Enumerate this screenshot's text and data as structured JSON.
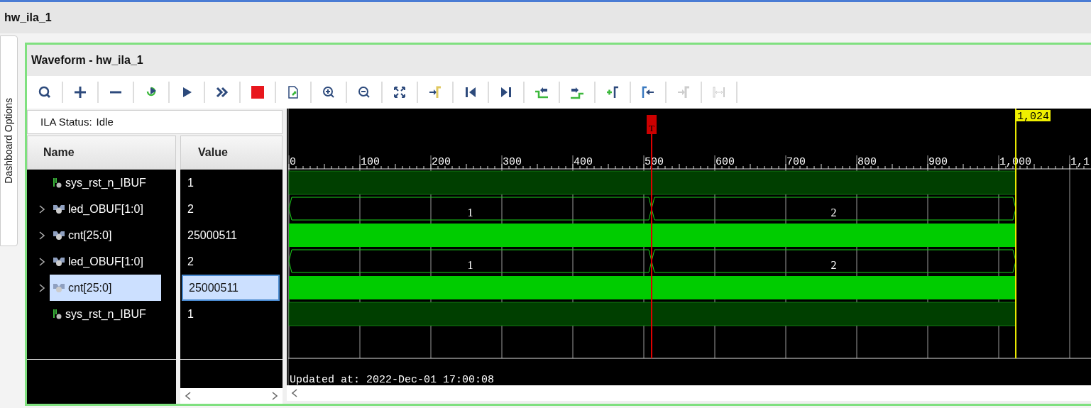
{
  "window": {
    "title": "hw_ila_1"
  },
  "side_tab": {
    "label": "Dashboard Options"
  },
  "panel": {
    "title": "Waveform - hw_ila_1"
  },
  "toolbar": [
    {
      "kind": "search",
      "disabled": false
    },
    {
      "kind": "add",
      "disabled": false
    },
    {
      "kind": "remove",
      "disabled": false
    },
    {
      "kind": "run-trigger",
      "disabled": false
    },
    {
      "kind": "play",
      "disabled": false
    },
    {
      "kind": "fast-forward",
      "disabled": false
    },
    {
      "kind": "stop",
      "disabled": false
    },
    {
      "kind": "export",
      "disabled": false
    },
    {
      "kind": "zoom-in",
      "disabled": false
    },
    {
      "kind": "zoom-out",
      "disabled": false
    },
    {
      "kind": "fit",
      "disabled": false
    },
    {
      "kind": "go-to-marker",
      "disabled": false
    },
    {
      "kind": "first",
      "disabled": false
    },
    {
      "kind": "last",
      "disabled": false
    },
    {
      "kind": "prev-transition",
      "disabled": false
    },
    {
      "kind": "next-transition",
      "disabled": false
    },
    {
      "kind": "add-marker",
      "disabled": false
    },
    {
      "kind": "prev-marker",
      "disabled": false
    },
    {
      "kind": "next-marker",
      "disabled": true
    },
    {
      "kind": "measure",
      "disabled": true
    }
  ],
  "status": {
    "label": "ILA Status:",
    "value": "Idle"
  },
  "columns": [
    "Name",
    "Value"
  ],
  "signals": [
    {
      "name": "sys_rst_n_IBUF",
      "value": "1",
      "kind": "bit",
      "expandable": false,
      "selected": false
    },
    {
      "name": "led_OBUF[1:0]",
      "value": "2",
      "kind": "bus",
      "expandable": true,
      "selected": false,
      "segments": [
        "1",
        "2"
      ]
    },
    {
      "name": "cnt[25:0]",
      "value": "25000511",
      "kind": "dense",
      "expandable": true,
      "selected": false
    },
    {
      "name": "led_OBUF[1:0]",
      "value": "2",
      "kind": "bus",
      "expandable": true,
      "selected": false,
      "segments": [
        "1",
        "2"
      ]
    },
    {
      "name": "cnt[25:0]",
      "value": "25000511",
      "kind": "dense",
      "expandable": true,
      "selected": true
    },
    {
      "name": "sys_rst_n_IBUF",
      "value": "1",
      "kind": "bit",
      "expandable": false,
      "selected": false
    }
  ],
  "timeline": {
    "ticks": [
      "0",
      "100",
      "200",
      "300",
      "400",
      "500",
      "600",
      "700",
      "800",
      "900",
      "1,000",
      "1,1"
    ],
    "trigger_label": "T",
    "cursor_label": "1,024"
  },
  "updated": "Updated at: 2022-Dec-01 17:00:08"
}
